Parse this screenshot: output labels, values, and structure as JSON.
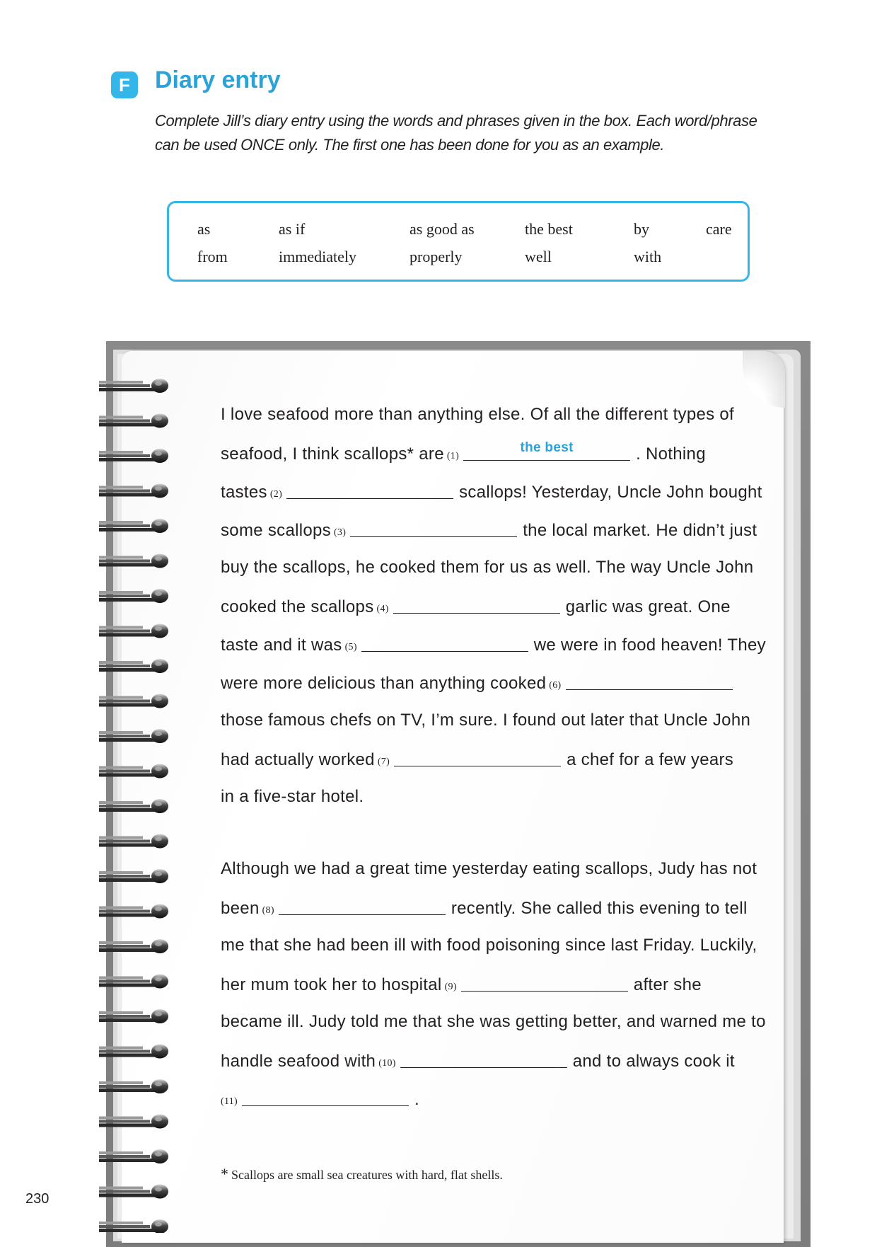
{
  "section": {
    "letter": "F",
    "title": "Diary entry",
    "instructions": "Complete Jill’s diary entry using the words and phrases given in the box. Each word/phrase can be used ONCE only. The first one has been done for you as an example."
  },
  "word_box": {
    "row1": [
      "as",
      "as if",
      "as good as",
      "the best",
      "by",
      "care"
    ],
    "row2": [
      "from",
      "immediately",
      "properly",
      "well",
      "with"
    ]
  },
  "diary": {
    "l1": "I love seafood more than anything else. Of all the different types of",
    "l2a": "seafood, I think scallops* are",
    "n1": "(1)",
    "a1": "the best",
    "l2b": ". Nothing",
    "l3a": "tastes",
    "n2": "(2)",
    "l3b": "scallops! Yesterday, Uncle John bought",
    "l4a": "some scallops",
    "n3": "(3)",
    "l4b": "the local market. He didn’t just",
    "l5": "buy the scallops, he cooked them for us as well. The way Uncle John",
    "l6a": "cooked the scallops",
    "n4": "(4)",
    "l6b": "garlic was great. One",
    "l7a": "taste and it was",
    "n5": "(5)",
    "l7b": "we were in food heaven! They",
    "l8a": "were more delicious than anything cooked",
    "n6": "(6)",
    "l9": "those famous chefs on TV, I’m sure. I found out later that Uncle John",
    "l10a": "had actually worked",
    "n7": "(7)",
    "l10b": "a chef for a few years",
    "l11": "in a five-star hotel.",
    "l12": "Although we had a great time yesterday eating scallops, Judy has not",
    "l13a": "been",
    "n8": "(8)",
    "l13b": "recently. She called this evening to tell",
    "l14": "me that she had been ill with food poisoning since last Friday. Luckily,",
    "l15a": "her mum took her to hospital",
    "n9": "(9)",
    "l15b": "after she",
    "l16": "became ill. Judy told me that she was getting better, and warned me to",
    "l17a": "handle seafood with",
    "n10": "(10)",
    "l17b": "and to always cook it",
    "n11": "(11)",
    "l18b": "."
  },
  "footnote": {
    "star": "*",
    "text": "Scallops are small sea creatures with hard, flat shells."
  },
  "page_number": "230",
  "colors": {
    "accent": "#35b6e9",
    "title": "#2ba3d9",
    "answer": "#2ba3d9"
  }
}
